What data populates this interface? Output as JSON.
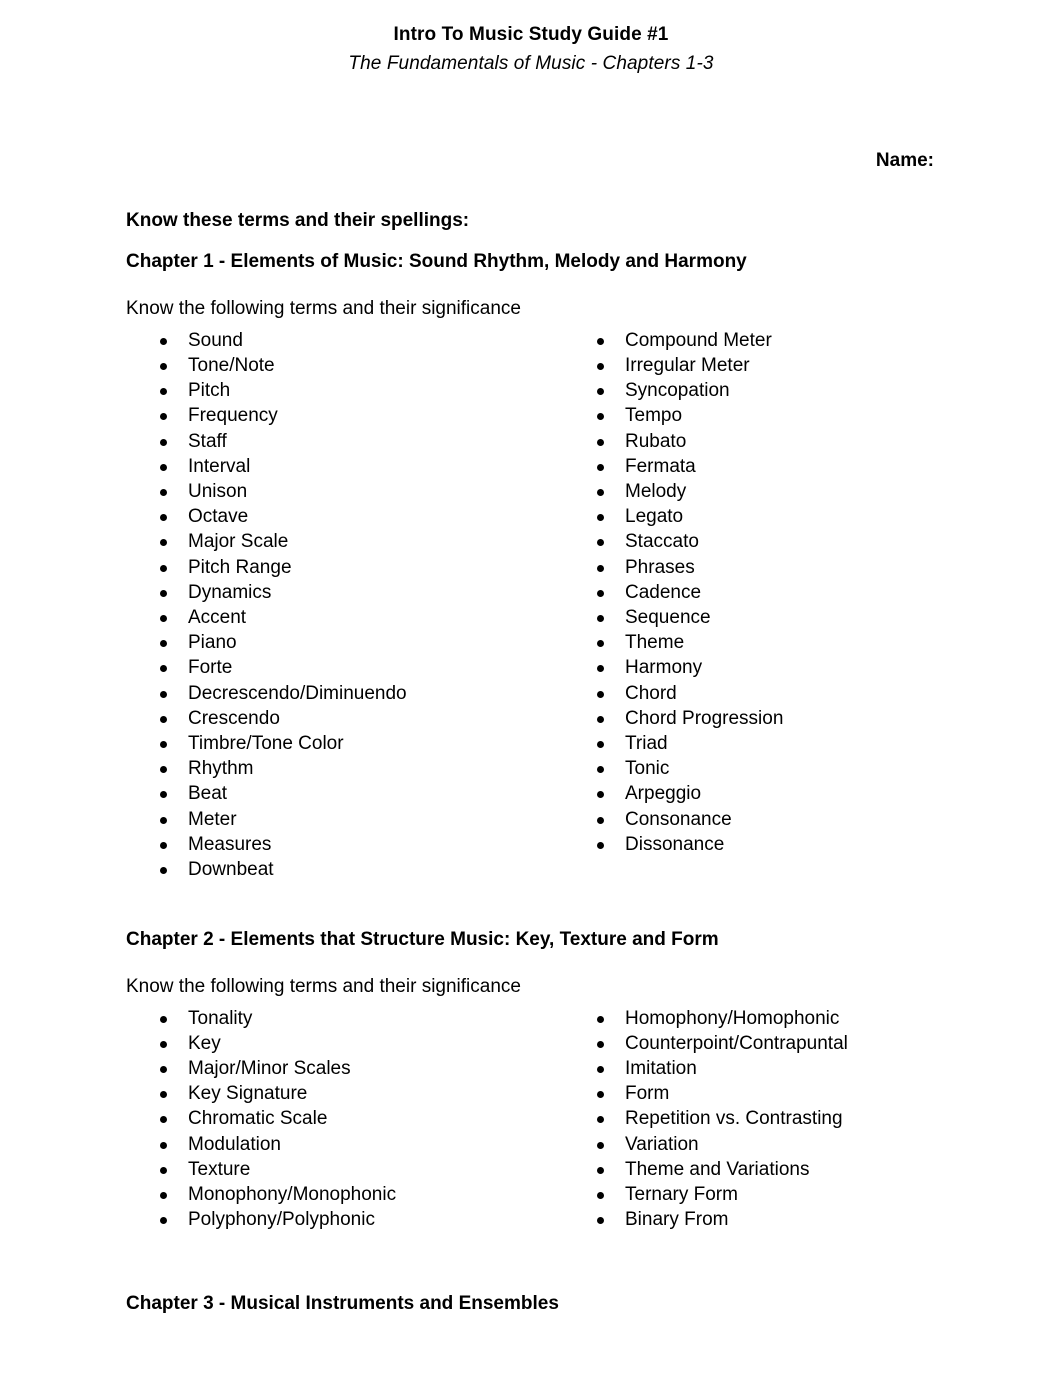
{
  "document": {
    "title": "Intro To Music Study Guide #1",
    "subtitle": "The Fundamentals of Music - Chapters 1-3",
    "name_label": "Name:",
    "instruction": "Know these terms and their spellings:"
  },
  "chapters": [
    {
      "heading": "Chapter 1 - Elements of Music: Sound Rhythm, Melody and Harmony",
      "intro": "Know the following terms and their significance",
      "left_terms": [
        "Sound",
        "Tone/Note",
        "Pitch",
        "Frequency",
        "Staff",
        "Interval",
        "Unison",
        "Octave",
        "Major Scale",
        "Pitch Range",
        "Dynamics",
        "Accent",
        "Piano",
        "Forte",
        "Decrescendo/Diminuendo",
        "Crescendo",
        "Timbre/Tone Color",
        "Rhythm",
        "Beat",
        "Meter",
        "Measures",
        "Downbeat"
      ],
      "right_terms": [
        "Compound Meter",
        "Irregular Meter",
        "Syncopation",
        "Tempo",
        "Rubato",
        "Fermata",
        "Melody",
        "Legato",
        "Staccato",
        "Phrases",
        "Cadence",
        "Sequence",
        "Theme",
        "Harmony",
        "Chord",
        "Chord Progression",
        "Triad",
        "Tonic",
        "Arpeggio",
        "Consonance",
        "Dissonance"
      ]
    },
    {
      "heading": "Chapter 2 - Elements that Structure Music: Key, Texture and Form",
      "intro": "Know the following terms and their significance",
      "left_terms": [
        "Tonality",
        "Key",
        "Major/Minor Scales",
        "Key Signature",
        "Chromatic Scale",
        "Modulation",
        "Texture",
        "Monophony/Monophonic",
        "Polyphony/Polyphonic"
      ],
      "right_terms": [
        "Homophony/Homophonic",
        "Counterpoint/Contrapuntal",
        "Imitation",
        "Form",
        "Repetition vs. Contrasting",
        "Variation",
        "Theme and Variations",
        "Ternary Form",
        "Binary From"
      ]
    },
    {
      "heading": "Chapter 3 - Musical Instruments and Ensembles",
      "intro": "",
      "left_terms": [],
      "right_terms": []
    }
  ]
}
